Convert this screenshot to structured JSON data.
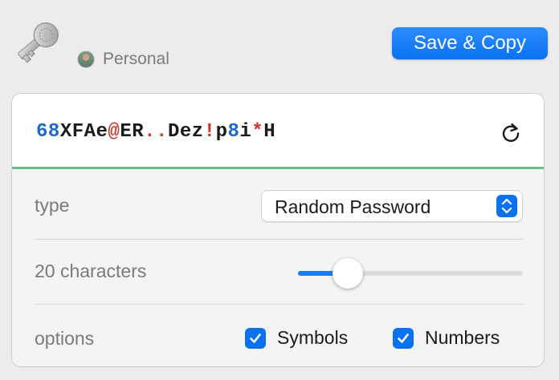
{
  "header": {
    "account_name": "Personal",
    "save_label": "Save & Copy"
  },
  "password": {
    "segments": [
      {
        "text": "68",
        "kind": "digit"
      },
      {
        "text": "XFAe",
        "kind": "letter"
      },
      {
        "text": "@",
        "kind": "symbol"
      },
      {
        "text": "ER",
        "kind": "letter"
      },
      {
        "text": "..",
        "kind": "symbol"
      },
      {
        "text": "Dez",
        "kind": "letter"
      },
      {
        "text": "!",
        "kind": "symbol"
      },
      {
        "text": "p",
        "kind": "letter"
      },
      {
        "text": "8",
        "kind": "digit"
      },
      {
        "text": "i",
        "kind": "letter"
      },
      {
        "text": "*",
        "kind": "symbol"
      },
      {
        "text": "H",
        "kind": "letter"
      }
    ],
    "colors": {
      "digit": "#1f67c9",
      "letter": "#1b1b1b",
      "symbol": "#c8392b"
    },
    "strength_color": "#5cc97a"
  },
  "settings": {
    "type_label": "type",
    "type_value": "Random Password",
    "length_label": "20 characters",
    "length_slider_fraction": 0.18,
    "options_label": "options",
    "symbols_label": "Symbols",
    "symbols_checked": true,
    "numbers_label": "Numbers",
    "numbers_checked": true
  },
  "icons": {
    "app": "key-icon",
    "refresh": "refresh-icon",
    "select": "chevron-up-down-icon",
    "check": "checkmark-icon"
  },
  "colors": {
    "accent": "#0a72f0",
    "background": "#ececec"
  }
}
